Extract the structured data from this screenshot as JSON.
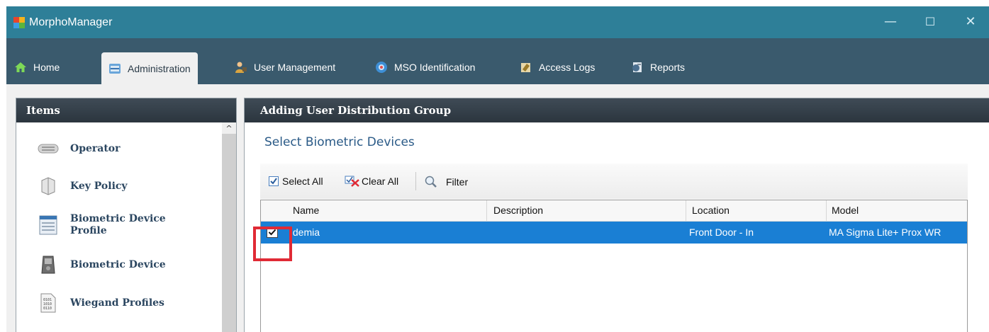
{
  "window": {
    "title": "MorphoManager",
    "controls": {
      "minimize": "—",
      "maximize": "☐",
      "close": "✕"
    }
  },
  "tabs": [
    {
      "label": "Home",
      "icon": "home-icon",
      "active": false
    },
    {
      "label": "Administration",
      "icon": "administration-icon",
      "active": true
    },
    {
      "label": "User Management",
      "icon": "user-management-icon",
      "active": false
    },
    {
      "label": "MSO Identification",
      "icon": "mso-identification-icon",
      "active": false
    },
    {
      "label": "Access Logs",
      "icon": "access-logs-icon",
      "active": false
    },
    {
      "label": "Reports",
      "icon": "reports-icon",
      "active": false
    }
  ],
  "left_panel": {
    "header": "Items",
    "items": [
      {
        "label": "Operator",
        "icon": "operator-icon"
      },
      {
        "label": "Key Policy",
        "icon": "key-policy-icon"
      },
      {
        "label": "Biometric Device\nProfile",
        "icon": "biometric-device-profile-icon"
      },
      {
        "label": "Biometric Device",
        "icon": "biometric-device-icon"
      },
      {
        "label": "Wiegand Profiles",
        "icon": "wiegand-profiles-icon"
      }
    ],
    "scroll_up": "^"
  },
  "right_panel": {
    "header": "Adding User Distribution Group",
    "section_title": "Select Biometric Devices",
    "toolbar": {
      "select_all": "Select All",
      "clear_all": "Clear All",
      "filter": "Filter"
    },
    "grid": {
      "columns": [
        "Name",
        "Description",
        "Location",
        "Model"
      ],
      "rows": [
        {
          "checked": true,
          "name": "Idemia",
          "description": "",
          "location": "Front Door - In",
          "model": "MA Sigma Lite+ Prox WR"
        }
      ]
    }
  },
  "colors": {
    "titlebar": "#2e7f98",
    "tabbar": "#3a5a6d",
    "selected_row": "#1a7fd4",
    "highlight": "#e02a35",
    "section_title": "#2a5a87"
  }
}
